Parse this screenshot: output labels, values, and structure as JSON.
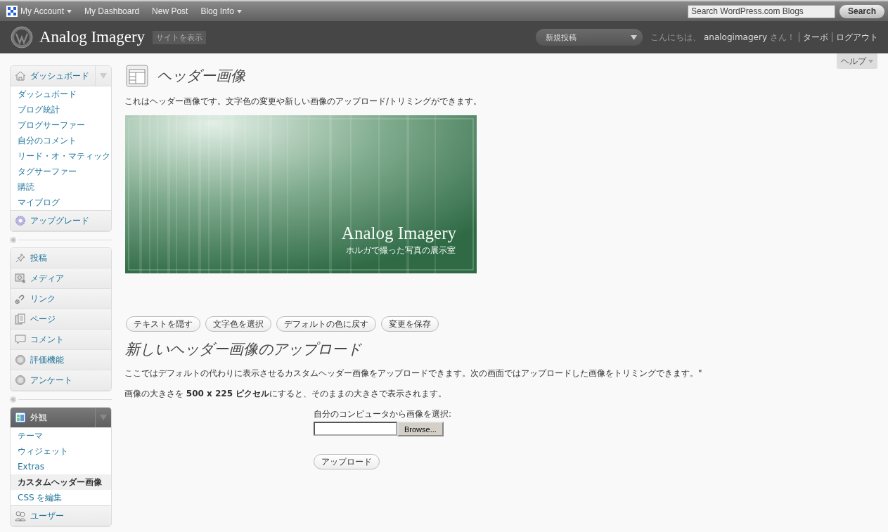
{
  "admin_bar": {
    "menus": [
      {
        "label": "My Account",
        "has_menu": true
      },
      {
        "label": "My Dashboard",
        "has_menu": false
      },
      {
        "label": "New Post",
        "has_menu": false
      },
      {
        "label": "Blog Info",
        "has_menu": true
      }
    ],
    "search": {
      "placeholder": "Search WordPress.com Blogs",
      "button": "Search"
    }
  },
  "header": {
    "site_title": "Analog Imagery",
    "view_site": "サイトを表示",
    "new_post_menu": "新規投稿",
    "greeting_prefix": "こんにちは、",
    "username": "analogimagery",
    "greeting_suffix": "さん！",
    "links": [
      "ターボ",
      "ログアウト"
    ]
  },
  "help_tab": "ヘルプ",
  "sidebar": {
    "groups": [
      {
        "items": [
          {
            "label": "ダッシュボード",
            "expanded": true,
            "current": false,
            "children": [
              {
                "label": "ダッシュボード",
                "selected": false
              },
              {
                "label": "ブログ統計",
                "selected": false
              },
              {
                "label": "ブログサーファー",
                "selected": false
              },
              {
                "label": "自分のコメント",
                "selected": false
              },
              {
                "label": "リード・オ・マティック",
                "selected": false
              },
              {
                "label": "タグサーファー",
                "selected": false
              },
              {
                "label": "購読",
                "selected": false
              },
              {
                "label": "マイブログ",
                "selected": false
              }
            ]
          },
          {
            "label": "アップグレード",
            "expanded": false,
            "current": false
          }
        ]
      },
      {
        "items": [
          {
            "label": "投稿",
            "expanded": false,
            "current": false
          },
          {
            "label": "メディア",
            "expanded": false,
            "current": false
          },
          {
            "label": "リンク",
            "expanded": false,
            "current": false
          },
          {
            "label": "ページ",
            "expanded": false,
            "current": false
          },
          {
            "label": "コメント",
            "expanded": false,
            "current": false
          },
          {
            "label": "評価機能",
            "expanded": false,
            "current": false
          },
          {
            "label": "アンケート",
            "expanded": false,
            "current": false
          }
        ]
      },
      {
        "items": [
          {
            "label": "外観",
            "expanded": true,
            "current": true,
            "children": [
              {
                "label": "テーマ",
                "selected": false
              },
              {
                "label": "ウィジェット",
                "selected": false
              },
              {
                "label": "Extras",
                "selected": false
              },
              {
                "label": "カスタムヘッダー画像",
                "selected": true
              },
              {
                "label": "CSS を編集",
                "selected": false
              }
            ]
          },
          {
            "label": "ユーザー",
            "expanded": false,
            "current": false
          }
        ]
      }
    ]
  },
  "main": {
    "title": "ヘッダー画像",
    "intro": "これはヘッダー画像です。文字色の変更や新しい画像のアップロード/トリミングができます。",
    "header_preview": {
      "title": "Analog Imagery",
      "tagline": "ホルガで撮った写真の展示室"
    },
    "buttons": [
      "テキストを隠す",
      "文字色を選択",
      "デフォルトの色に戻す",
      "変更を保存"
    ],
    "upload_heading": "新しいヘッダー画像のアップロード",
    "upload_text": "ここではデフォルトの代わりに表示させるカスタムヘッダー画像をアップロードできます。次の画面ではアップロードした画像をトリミングできます。\"",
    "size_text": "画像の大きさを **500 x 225 ピクセル**にすると、そのままの大きさで表示されます。",
    "file_label": "自分のコンピュータから画像を選択:",
    "browse_button": "Browse...",
    "upload_button": "アップロード"
  }
}
